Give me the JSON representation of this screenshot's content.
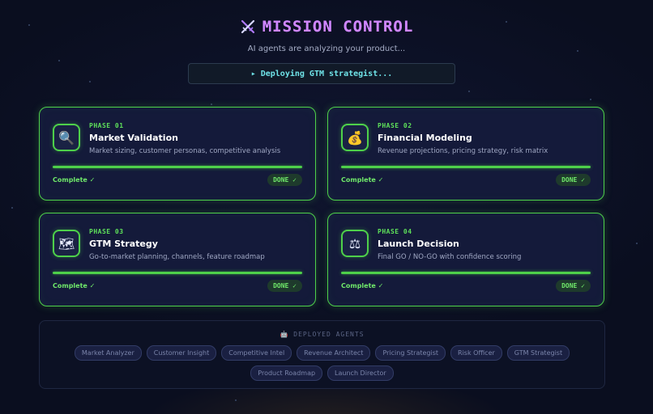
{
  "header": {
    "title": "MISSION CONTROL",
    "subtitle": "AI agents are analyzing your product...",
    "icon": "crossed-swords-icon"
  },
  "status": {
    "text": "▸ Deploying GTM strategist..."
  },
  "phases": [
    {
      "phase": "PHASE 01",
      "title": "Market Validation",
      "description": "Market sizing, customer personas, competitive analysis",
      "icon": "magnifying-glass-icon",
      "glyph": "🔍",
      "progress": 1.0,
      "status": "Complete ✓",
      "badge": "DONE ✓"
    },
    {
      "phase": "PHASE 02",
      "title": "Financial Modeling",
      "description": "Revenue projections, pricing strategy, risk matrix",
      "icon": "money-bag-icon",
      "glyph": "💰",
      "progress": 1.0,
      "status": "Complete ✓",
      "badge": "DONE ✓"
    },
    {
      "phase": "PHASE 03",
      "title": "GTM Strategy",
      "description": "Go-to-market planning, channels, feature roadmap",
      "icon": "map-icon",
      "glyph": "🗺",
      "progress": 1.0,
      "status": "Complete ✓",
      "badge": "DONE ✓"
    },
    {
      "phase": "PHASE 04",
      "title": "Launch Decision",
      "description": "Final GO / NO-GO with confidence scoring",
      "icon": "balance-scale-icon",
      "glyph": "⚖",
      "progress": 1.0,
      "status": "Complete ✓",
      "badge": "DONE ✓"
    }
  ],
  "agents": {
    "heading": "🤖 DEPLOYED AGENTS",
    "row1": [
      "Market Analyzer",
      "Customer Insight",
      "Competitive Intel",
      "Revenue Architect",
      "Pricing Strategist",
      "Risk Officer",
      "GTM Strategist"
    ],
    "row2": [
      "Product Roadmap",
      "Launch Director"
    ]
  },
  "colors": {
    "background": "#0a0e1f",
    "accent_green": "#4ed04a",
    "title_purple": "#cf86ff",
    "status_cyan": "#6fe3e8"
  }
}
